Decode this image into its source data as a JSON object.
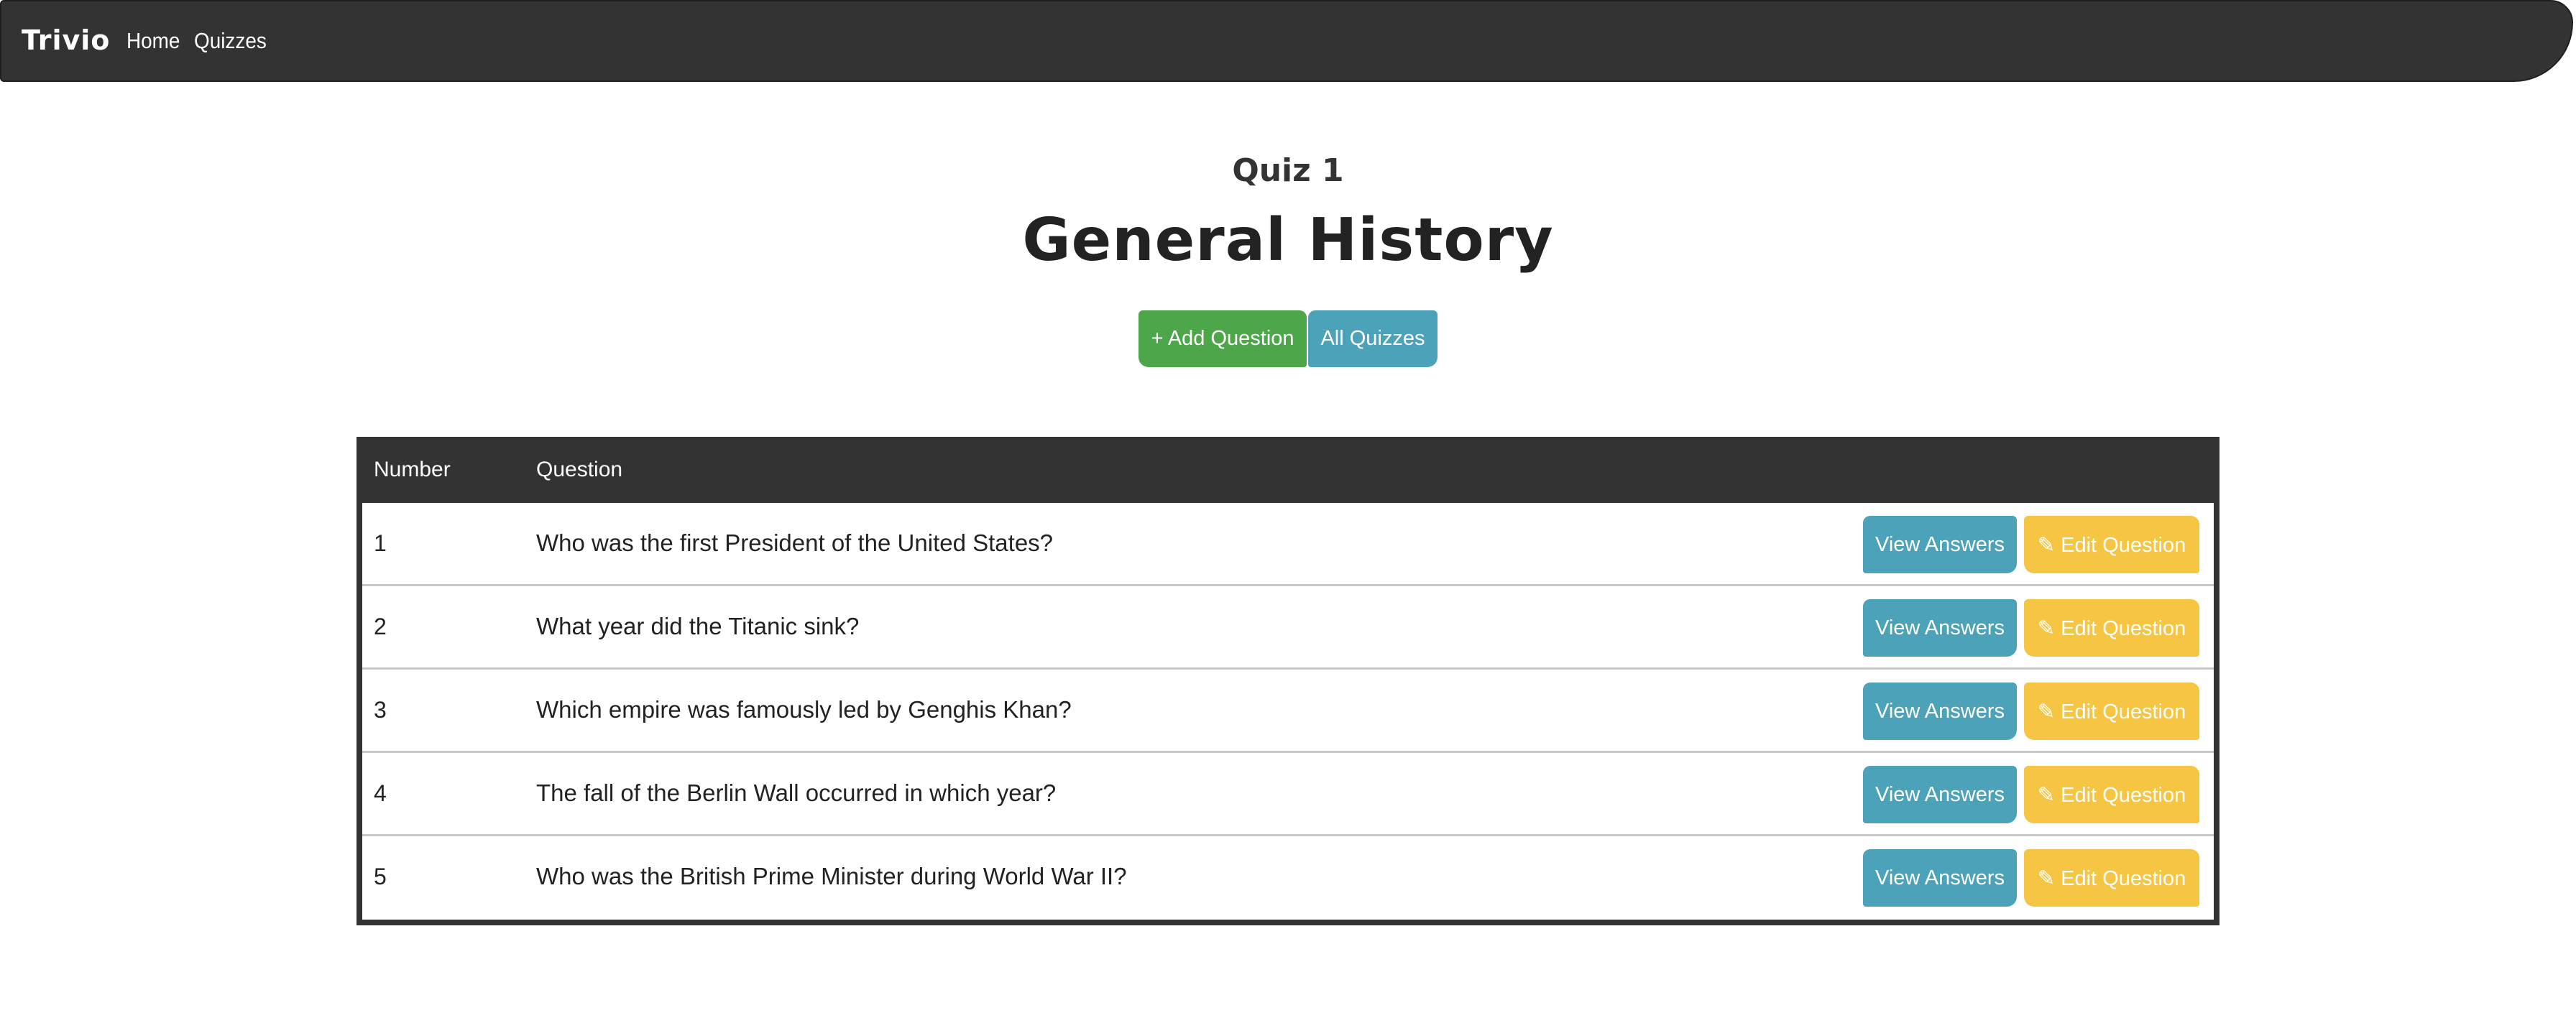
{
  "navbar": {
    "brand": "Trivio",
    "links": [
      "Home",
      "Quizzes"
    ]
  },
  "header": {
    "subtitle": "Quiz 1",
    "title": "General History"
  },
  "actions": {
    "add_question": "+ Add Question",
    "all_quizzes": "All Quizzes"
  },
  "table": {
    "columns": [
      "Number",
      "Question"
    ],
    "rows": [
      {
        "number": "1",
        "question": "Who was the first President of the United States?"
      },
      {
        "number": "2",
        "question": "What year did the Titanic sink?"
      },
      {
        "number": "3",
        "question": "Which empire was famously led by Genghis Khan?"
      },
      {
        "number": "4",
        "question": "The fall of the Berlin Wall occurred in which year?"
      },
      {
        "number": "5",
        "question": "Who was the British Prime Minister during World War II?"
      }
    ],
    "view_answers_label": "View Answers",
    "edit_question_label": "✎ Edit Question"
  },
  "colors": {
    "navbar": "#333333",
    "success": "#4ea64b",
    "info": "#4ca2b8",
    "warning": "#f5c543"
  }
}
